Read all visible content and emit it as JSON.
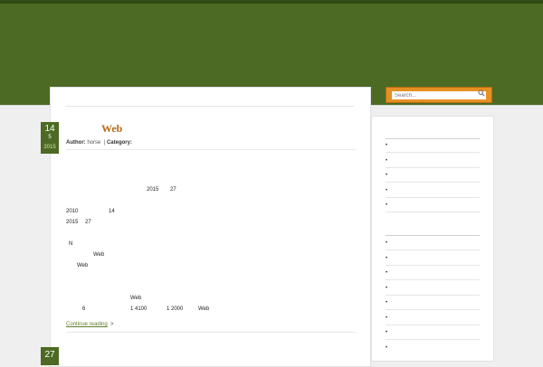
{
  "search": {
    "placeholder": "Search..."
  },
  "post": {
    "date": {
      "day": "14",
      "month": "5",
      "year": "2015"
    },
    "title": "Web",
    "meta": {
      "author_label": "Author:",
      "author": "horse",
      "separator": "|",
      "category_label": "Category:"
    },
    "body_fragments": {
      "a1": "2015",
      "a2": "27",
      "b1": "2010",
      "b2": "14",
      "c1": "2015",
      "c2": "27",
      "d1": "N",
      "e1": "Web",
      "f1": "Web",
      "g1": "Web",
      "h1": "6",
      "h2": "1 4100",
      "h3": "1 2000",
      "h4": "Web"
    },
    "continue_label": "Continue reading",
    "continue_arrow": ">"
  },
  "next_post": {
    "day": "27"
  },
  "sidebar": {
    "bullet": "•"
  }
}
